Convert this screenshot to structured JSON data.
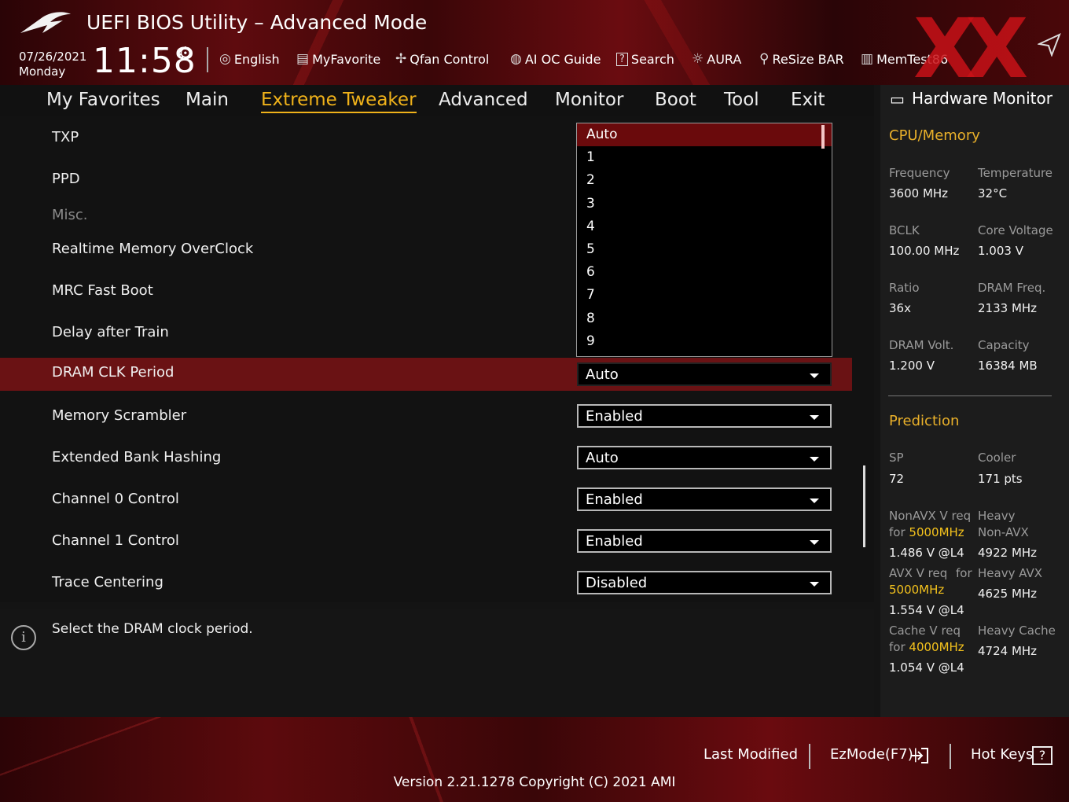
{
  "header": {
    "title": "UEFI BIOS Utility – Advanced Mode",
    "date": "07/26/2021",
    "day": "Monday",
    "time": "11:58",
    "tools": [
      {
        "icon": "globe-icon",
        "label": "English"
      },
      {
        "icon": "favorite-icon",
        "label": "MyFavorite"
      },
      {
        "icon": "fan-icon",
        "label": "Qfan Control"
      },
      {
        "icon": "ai-oc-icon",
        "label": "AI OC Guide"
      },
      {
        "icon": "search-icon",
        "label": "Search"
      },
      {
        "icon": "aura-icon",
        "label": "AURA"
      },
      {
        "icon": "resize-bar-icon",
        "label": "ReSize BAR"
      },
      {
        "icon": "memtest-icon",
        "label": "MemTest86"
      }
    ]
  },
  "nav": {
    "tabs": [
      "My Favorites",
      "Main",
      "Extreme Tweaker",
      "Advanced",
      "Monitor",
      "Boot",
      "Tool",
      "Exit"
    ],
    "active": "Extreme Tweaker"
  },
  "settings": [
    {
      "label": "TXP"
    },
    {
      "label": "PPD"
    },
    {
      "label": "Misc.",
      "section": true
    },
    {
      "label": "Realtime Memory OverClock"
    },
    {
      "label": "MRC Fast Boot"
    },
    {
      "label": "Delay after Train"
    },
    {
      "label": "DRAM CLK Period",
      "value": "Auto",
      "selected": true
    },
    {
      "label": "Memory Scrambler",
      "value": "Enabled"
    },
    {
      "label": "Extended Bank Hashing",
      "value": "Auto"
    },
    {
      "label": "Channel 0 Control",
      "value": "Enabled"
    },
    {
      "label": "Channel 1 Control",
      "value": "Enabled"
    },
    {
      "label": "Trace Centering",
      "value": "Disabled"
    }
  ],
  "dropdown": {
    "options": [
      "Auto",
      "1",
      "2",
      "3",
      "4",
      "5",
      "6",
      "7",
      "8",
      "9"
    ],
    "highlighted": "Auto"
  },
  "help": {
    "text": "Select the DRAM clock period."
  },
  "hw_monitor": {
    "title": "Hardware Monitor",
    "cpu_memory": {
      "heading": "CPU/Memory",
      "frequency_label": "Frequency",
      "frequency": "3600 MHz",
      "temperature_label": "Temperature",
      "temperature": "32°C",
      "bclk_label": "BCLK",
      "bclk": "100.00 MHz",
      "core_voltage_label": "Core Voltage",
      "core_voltage": "1.003 V",
      "ratio_label": "Ratio",
      "ratio": "36x",
      "dram_freq_label": "DRAM Freq.",
      "dram_freq": "2133 MHz",
      "dram_volt_label": "DRAM Volt.",
      "dram_volt": "1.200 V",
      "capacity_label": "Capacity",
      "capacity": "16384 MB"
    },
    "prediction": {
      "heading": "Prediction",
      "sp_label": "SP",
      "sp": "72",
      "cooler_label": "Cooler",
      "cooler": "171 pts",
      "nonavx_label_1": "NonAVX V req",
      "nonavx_label_2": "for",
      "nonavx_freq": "5000MHz",
      "nonavx_value": "1.486 V @L4",
      "heavy_nonavx_label_1": "Heavy",
      "heavy_nonavx_label_2": "Non-AVX",
      "heavy_nonavx": "4922 MHz",
      "avx_label": "AVX V req",
      "avx_for": "for",
      "avx_freq": "5000MHz",
      "avx_value": "1.554 V @L4",
      "heavy_avx_label": "Heavy AVX",
      "heavy_avx": "4625 MHz",
      "cache_label_1": "Cache V req",
      "cache_label_2": "for",
      "cache_freq": "4000MHz",
      "cache_value": "1.054 V @L4",
      "heavy_cache_label": "Heavy Cache",
      "heavy_cache": "4724 MHz"
    }
  },
  "footer": {
    "last_modified": "Last Modified",
    "ezmode": "EzMode(F7)|",
    "hot_keys": "Hot Keys",
    "version": "Version 2.21.1278 Copyright (C) 2021 AMI"
  }
}
